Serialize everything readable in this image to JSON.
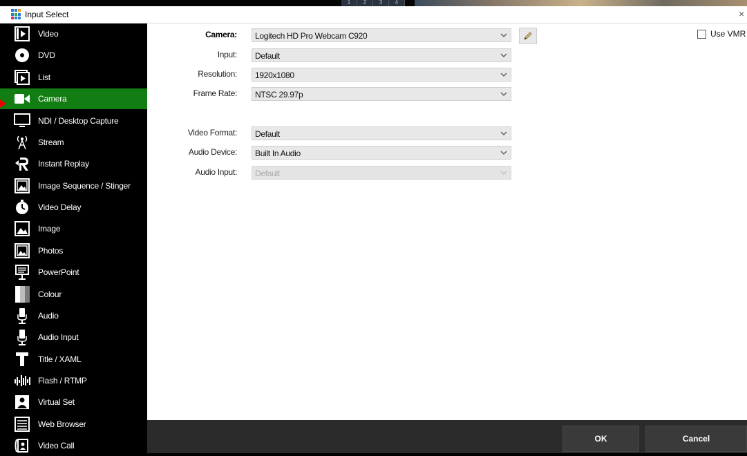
{
  "background_tabs": [
    "1",
    "2",
    "3",
    "4"
  ],
  "window": {
    "title": "Input Select",
    "close_glyph": "×",
    "icon": "vmix-grid-icon"
  },
  "sidebar": {
    "items": [
      {
        "label": "Video",
        "icon": "video-file-icon"
      },
      {
        "label": "DVD",
        "icon": "disc-icon"
      },
      {
        "label": "List",
        "icon": "list-icon"
      },
      {
        "label": "Camera",
        "icon": "camera-icon",
        "active": true
      },
      {
        "label": "NDI / Desktop Capture",
        "icon": "monitor-icon"
      },
      {
        "label": "Stream",
        "icon": "antenna-icon"
      },
      {
        "label": "Instant Replay",
        "icon": "replay-icon"
      },
      {
        "label": "Image Sequence / Stinger",
        "icon": "image-sequence-icon"
      },
      {
        "label": "Video Delay",
        "icon": "timer-icon"
      },
      {
        "label": "Image",
        "icon": "image-icon"
      },
      {
        "label": "Photos",
        "icon": "photos-icon"
      },
      {
        "label": "PowerPoint",
        "icon": "presentation-icon"
      },
      {
        "label": "Colour",
        "icon": "colour-icon"
      },
      {
        "label": "Audio",
        "icon": "microphone-icon"
      },
      {
        "label": "Audio Input",
        "icon": "microphone-icon"
      },
      {
        "label": "Title / XAML",
        "icon": "title-icon"
      },
      {
        "label": "Flash / RTMP",
        "icon": "waveform-icon"
      },
      {
        "label": "Virtual Set",
        "icon": "virtual-set-icon"
      },
      {
        "label": "Web Browser",
        "icon": "browser-icon"
      },
      {
        "label": "Video Call",
        "icon": "video-call-icon"
      }
    ]
  },
  "camera": {
    "camera_label": "Camera:",
    "camera_value": "Logitech HD Pro Webcam C920",
    "input_label": "Input:",
    "input_value": "Default",
    "resolution_label": "Resolution:",
    "resolution_value": "1920x1080",
    "frame_rate_label": "Frame Rate:",
    "frame_rate_value": "NTSC 29.97p",
    "video_format_label": "Video Format:",
    "video_format_value": "Default",
    "audio_device_label": "Audio Device:",
    "audio_device_value": "Built In Audio",
    "audio_input_label": "Audio Input:",
    "audio_input_value": "Default",
    "use_vmr_label": "Use VMR",
    "use_vmr_checked": false
  },
  "footer": {
    "ok_label": "OK",
    "cancel_label": "Cancel"
  },
  "colors": {
    "active_item": "#127d12",
    "sidebar_bg": "#000000",
    "footer_bg": "#2b2b2b",
    "indicator_arrow": "#e00000"
  }
}
